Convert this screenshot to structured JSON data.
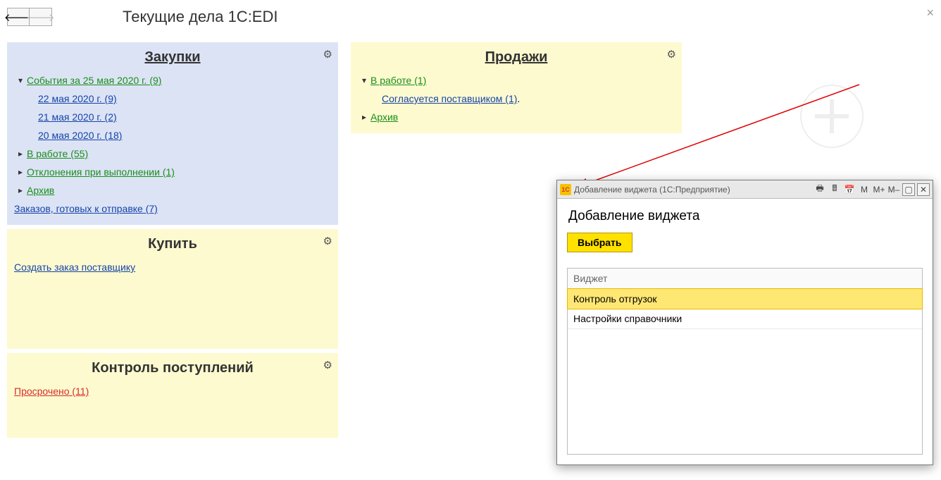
{
  "header": {
    "title": "Текущие дела 1C:EDI"
  },
  "widgets": {
    "purchases": {
      "title": "Закупки",
      "events_label": "События за 25 мая 2020 г. (9)",
      "dates": {
        "d22": "22 мая 2020 г. (9)",
        "d21": "21 мая 2020 г. (2)",
        "d20": "20 мая 2020 г. (18)"
      },
      "in_work": "В работе (55)",
      "deviations": "Отклонения при выполнении (1)",
      "archive": "Архив",
      "ready": "Заказов, готовых к отправке (7)"
    },
    "buy": {
      "title": "Купить",
      "create_order": "Создать заказ поставщику"
    },
    "receipts": {
      "title": "Контроль поступлений",
      "overdue": "Просрочено (11)"
    },
    "sales": {
      "title": "Продажи",
      "in_work": "В работе (1)",
      "agreed": "Согласуется поставщиком (1)",
      "archive": "Архив"
    }
  },
  "dialog": {
    "window_title": "Добавление виджета  (1С:Предприятие)",
    "heading": "Добавление виджета",
    "choose_btn": "Выбрать",
    "column": "Виджет",
    "rows": {
      "r0": "Контроль отгрузок",
      "r1": "Настройки справочники"
    },
    "m": "M",
    "mplus": "M+",
    "mminus": "M–"
  }
}
